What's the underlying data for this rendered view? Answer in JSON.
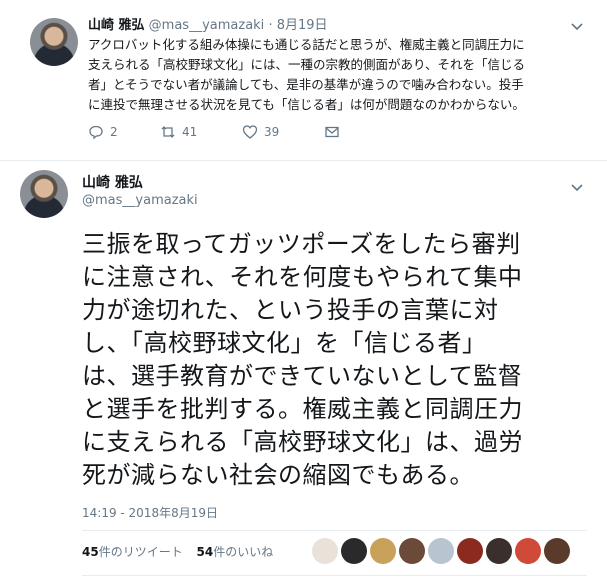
{
  "tweet1": {
    "name": "山崎 雅弘",
    "handle": "@mas__yamazaki",
    "separator": "·",
    "date": "8月19日",
    "lines": [
      "アクロバット化する組み体操にも通じる話だと思うが、権威主義と同調圧力に",
      "支えられる「高校野球文化」には、一種の宗教的側面があり、それを「信じる",
      "者」とそうでない者が議論しても、是非の基準が違うので噛み合わない。投手",
      "に連投で無理させる状況を見ても「信じる者」は何が問題なのかわからない。"
    ],
    "actions": {
      "reply_count": "2",
      "retweet_count": "41",
      "like_count": "39"
    }
  },
  "tweet2": {
    "name": "山崎 雅弘",
    "handle": "@mas__yamazaki",
    "lines": [
      "三振を取ってガッツポーズをしたら審判",
      "に注意され、それを何度もやられて集中",
      "力が途切れた、という投手の言葉に対",
      "し、「高校野球文化」を「信じる者」",
      "は、選手教育ができていないとして監督",
      "と選手を批判する。権威主義と同調圧力",
      "に支えられる「高校野球文化」は、過労",
      "死が減らない社会の縮図でもある。"
    ],
    "timestamp": "14:19 - 2018年8月19日",
    "stats": {
      "retweets_count": "45",
      "retweets_label": "件のリツイート",
      "likes_count": "54",
      "likes_label": "件のいいね"
    },
    "liker_colors": [
      "#e8e2d8",
      "#2a2a2a",
      "#c9a25a",
      "#6b4a3a",
      "#b8c4d0",
      "#8b2a1e",
      "#3a2f2a",
      "#d04a3a",
      "#5a3a2a"
    ]
  },
  "icons": {
    "chevron": "chevron-down-icon",
    "reply": "reply-icon",
    "retweet": "retweet-icon",
    "like": "heart-icon",
    "dm": "envelope-icon"
  },
  "colors": {
    "text": "#14171a",
    "secondary": "#657786",
    "divider": "#e6ecf0"
  }
}
